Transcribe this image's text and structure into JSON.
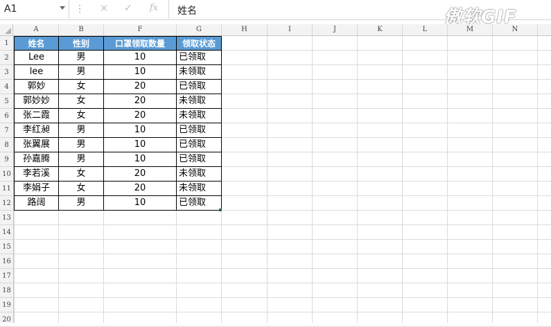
{
  "formula_bar": {
    "name_box": "A1",
    "cancel_icon": "×",
    "enter_icon": "✓",
    "fx_icon": "fx",
    "content": "姓名"
  },
  "watermark": "傲软GIF",
  "columns": [
    "A",
    "B",
    "F",
    "G",
    "H",
    "I",
    "J",
    "K",
    "L",
    "M",
    "N"
  ],
  "rows": [
    "1",
    "2",
    "3",
    "4",
    "5",
    "6",
    "7",
    "8",
    "9",
    "10",
    "11",
    "12",
    "13",
    "14",
    "15",
    "16",
    "17",
    "18",
    "19",
    "20"
  ],
  "table": {
    "headers": [
      "姓名",
      "性别",
      "口罩领取数量",
      "领取状态"
    ],
    "rows": [
      [
        "Lee",
        "男",
        "10",
        "已领取"
      ],
      [
        "lee",
        "男",
        "10",
        "未领取"
      ],
      [
        "郭妙",
        "女",
        "20",
        "已领取"
      ],
      [
        "郭妙妙",
        "女",
        "20",
        "未领取"
      ],
      [
        "张二霞",
        "女",
        "20",
        "未领取"
      ],
      [
        "李红昶",
        "男",
        "10",
        "已领取"
      ],
      [
        "张翼展",
        "男",
        "10",
        "已领取"
      ],
      [
        "孙嘉腾",
        "男",
        "10",
        "已领取"
      ],
      [
        "李若溪",
        "女",
        "20",
        "未领取"
      ],
      [
        "李娟子",
        "女",
        "20",
        "未领取"
      ],
      [
        "路阔",
        "男",
        "10",
        "已领取"
      ]
    ]
  },
  "colors": {
    "header_fill": "#5b9bd5",
    "fill_handle": "#217346"
  }
}
